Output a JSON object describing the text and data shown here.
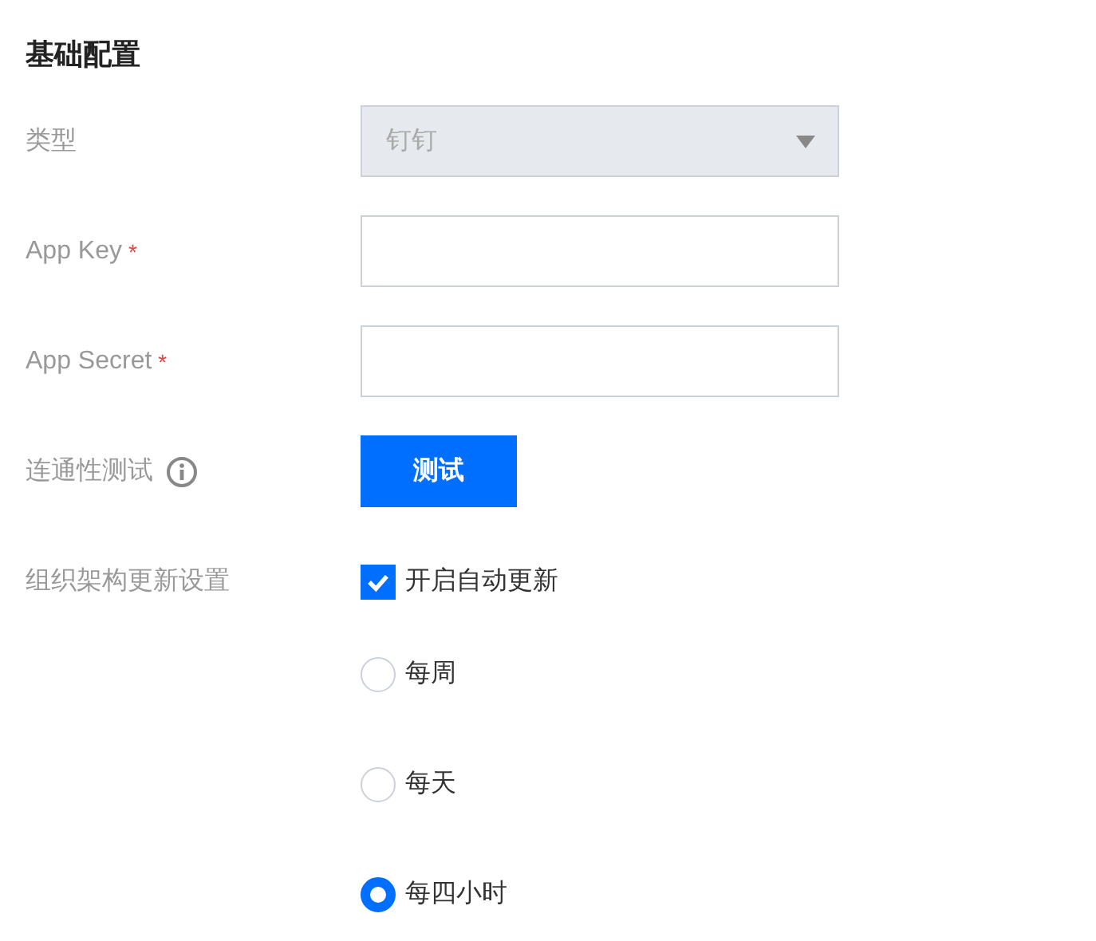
{
  "section_title": "基础配置",
  "rows": [
    {
      "kind": "select",
      "label": "类型",
      "value": "钉钉",
      "disabled": true
    },
    {
      "kind": "input",
      "label": "App Key",
      "required_mark": "*",
      "value": ""
    },
    {
      "kind": "input",
      "label": "App Secret",
      "required_mark": "*",
      "value": ""
    },
    {
      "kind": "button",
      "label": "连通性测试",
      "info": true,
      "button": "测试"
    },
    {
      "kind": "options",
      "label": "组织架构更新设置",
      "checkbox": {
        "label": "开启自动更新",
        "checked": true
      },
      "radios": [
        {
          "label": "每周",
          "selected": false
        },
        {
          "label": "每天",
          "selected": false
        },
        {
          "label": "每四小时",
          "selected": true
        }
      ]
    }
  ]
}
